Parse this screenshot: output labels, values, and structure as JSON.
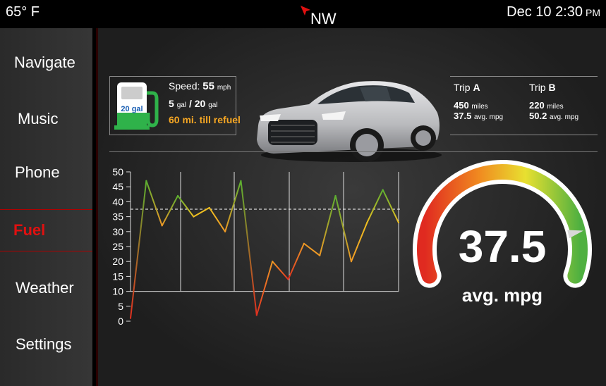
{
  "status": {
    "temperature": "65° F",
    "heading": "NW",
    "date": "Dec 10",
    "time": "2:30",
    "ampm": "PM"
  },
  "sidebar": {
    "items": [
      {
        "label": "Navigate",
        "active": false
      },
      {
        "label": "Music",
        "active": false
      },
      {
        "label": "Phone",
        "active": false
      },
      {
        "label": "Fuel",
        "active": true
      },
      {
        "label": "Weather",
        "active": false
      },
      {
        "label": "Settings",
        "active": false
      }
    ]
  },
  "fuel": {
    "icon": "fuel-pump-icon",
    "tank_label": "20 gal",
    "speed_label": "Speed:",
    "speed_value": "55",
    "speed_unit": "mph",
    "gallons_current": "5",
    "gallons_unit": "gal",
    "gallons_separator": "/",
    "gallons_capacity": "20",
    "refuel_text": "60 mi. till refuel",
    "refuel_color": "#f5a623"
  },
  "trips": [
    {
      "label": "Trip",
      "letter": "A",
      "miles": "450",
      "miles_unit": "miles",
      "mpg": "37.5",
      "mpg_unit": "avg. mpg"
    },
    {
      "label": "Trip",
      "letter": "B",
      "miles": "220",
      "miles_unit": "miles",
      "mpg": "50.2",
      "mpg_unit": "avg. mpg"
    }
  ],
  "gauge": {
    "value": "37.5",
    "label": "avg. mpg",
    "level": 0.85
  },
  "chart_data": {
    "type": "line",
    "ylim": [
      0,
      50
    ],
    "yticks": [
      "0",
      "5",
      "10",
      "15",
      "20",
      "25",
      "30",
      "35",
      "40",
      "45",
      "50"
    ],
    "reference_line": 37.5,
    "x": [
      0,
      1,
      2,
      3,
      4,
      5,
      6,
      7,
      8,
      9,
      10,
      11,
      12,
      13,
      14,
      15,
      16,
      17,
      18,
      19,
      20
    ],
    "values": [
      1,
      47,
      32,
      42,
      35,
      38,
      30,
      47,
      2,
      20,
      14,
      26,
      22,
      42,
      20,
      33,
      44,
      33
    ],
    "grid": true,
    "colors": {
      "low": "#e03020",
      "mid": "#f0c020",
      "high": "#5cb030"
    }
  }
}
